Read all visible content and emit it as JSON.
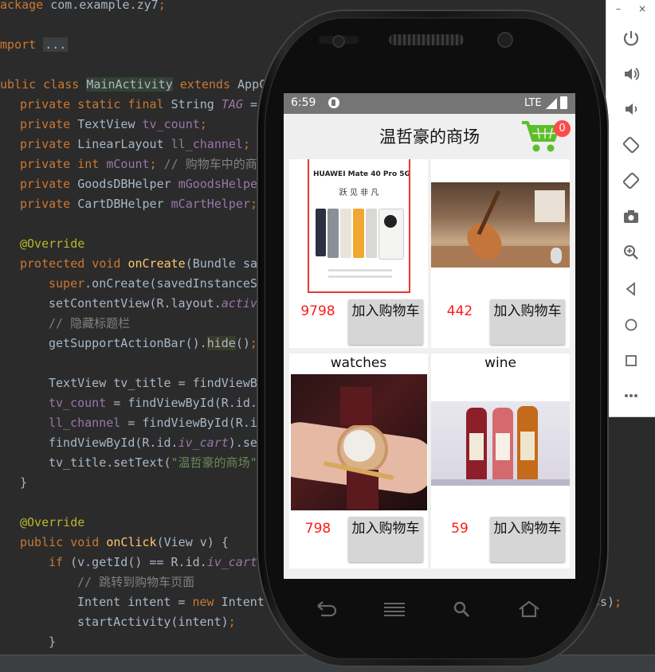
{
  "editor": {
    "lines": [
      "ackage com.example.zy7;",
      "mport ...",
      "ublic class MainActivity extends AppC",
      "private static final String TAG =",
      "private TextView tv_count;",
      "private LinearLayout ll_channel;",
      "private int mCount; // 购物车中的商",
      "private GoodsDBHelper mGoodsHelpe",
      "private CartDBHelper mCartHelper;",
      "@Override",
      "protected void onCreate(Bundle sa",
      "super.onCreate(savedInstanceS",
      "setContentView(R.layout.activ",
      "// 隐藏标题栏",
      "getSupportActionBar().hide();",
      "TextView tv_title = findViewBy",
      "tv_count = findViewById(R.id.",
      "ll_channel = findViewById(R.id",
      "findViewById(R.id.iv_cart).set",
      "tv_title.setText(\"温哲豪的商场\"",
      "}",
      "@Override",
      "public void onClick(View v) {",
      "if (v.getId() == R.id.iv_cart",
      "// 跳转到购物车页面",
      "Intent intent = new Intent",
      "startActivity(intent);",
      "}",
      "ss);"
    ]
  },
  "emulator": {
    "window_minimize": "–",
    "window_close": "×",
    "tools": [
      "power-icon",
      "volume-up-icon",
      "volume-down-icon",
      "rotate-left-icon",
      "rotate-right-icon",
      "screenshot-icon",
      "zoom-icon",
      "back-icon",
      "home-icon",
      "overview-icon",
      "more-icon"
    ]
  },
  "phone": {
    "status": {
      "time": "6:59",
      "network": "LTE"
    },
    "app": {
      "title": "温哲豪的商场",
      "cart_count": "0",
      "products": [
        {
          "name": "",
          "price": "9798",
          "button": "加入购物车",
          "image_text": "HUAWEI Mate 40 Pro 5G",
          "image_slogan": "跃 见 非 凡"
        },
        {
          "name": "",
          "price": "442",
          "button": "加入购物车"
        },
        {
          "name": "watches",
          "price": "798",
          "button": "加入购物车"
        },
        {
          "name": "wine",
          "price": "59",
          "button": "加入购物车"
        }
      ]
    }
  },
  "colors": {
    "accent_green": "#5bbf2a",
    "price_red": "#ff1a1a",
    "badge_red": "#ff4a4a"
  }
}
